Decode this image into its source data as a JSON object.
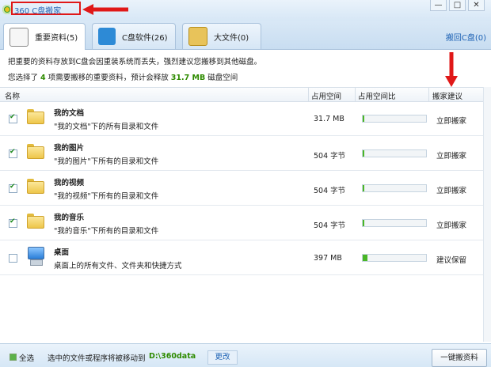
{
  "app": {
    "title": "360 C盘搬家"
  },
  "window_controls": {
    "minimize": "—",
    "maximize": "□",
    "close": "✕"
  },
  "tabs": [
    {
      "label": "重要资料(5)",
      "icon": "important-docs-icon",
      "active": true
    },
    {
      "label": "C盘软件(26)",
      "icon": "c-drive-software-icon",
      "active": false
    },
    {
      "label": "大文件(0)",
      "icon": "large-files-icon",
      "active": false
    }
  ],
  "restore_link": "搬回C盘(0)",
  "info": {
    "line1": "把重要的资料存放到C盘会因重装系统而丢失，强烈建议您搬移到其他磁盘。",
    "line2_prefix": "您选择了",
    "selected_count": "4",
    "line2_middle": "项需要搬移的重要资料，预计会释放",
    "release_size": "31.7 MB",
    "line2_suffix": "磁盘空间"
  },
  "table": {
    "headers": {
      "name": "名称",
      "size": "占用空间",
      "ratio": "占用空间比",
      "suggestion": "搬家建议"
    },
    "rows": [
      {
        "checked": true,
        "icon": "folder-icon",
        "name": "我的文档",
        "desc": "\"我的文档\"下的所有目录和文件",
        "size": "31.7 MB",
        "ratio": 0.03,
        "suggestion": "立即搬家"
      },
      {
        "checked": true,
        "icon": "folder-icon",
        "name": "我的图片",
        "desc": "\"我的图片\"下所有的目录和文件",
        "size": "504 字节",
        "ratio": 0.02,
        "suggestion": "立即搬家"
      },
      {
        "checked": true,
        "icon": "folder-icon",
        "name": "我的视频",
        "desc": "\"我的视频\"下所有的目录和文件",
        "size": "504 字节",
        "ratio": 0.02,
        "suggestion": "立即搬家"
      },
      {
        "checked": true,
        "icon": "folder-icon",
        "name": "我的音乐",
        "desc": "\"我的音乐\"下所有的目录和文件",
        "size": "504 字节",
        "ratio": 0.02,
        "suggestion": "立即搬家"
      },
      {
        "checked": false,
        "icon": "desktop-computer-icon",
        "name": "桌面",
        "desc": "桌面上的所有文件、文件夹和快捷方式",
        "size": "397 MB",
        "ratio": 0.08,
        "suggestion": "建议保留"
      }
    ]
  },
  "footer": {
    "select_all": "全选",
    "hint": "选中的文件或程序将被移动到",
    "target_path": "D:\\360data",
    "change_button": "更改",
    "move_button": "一键搬资料"
  },
  "colors": {
    "accent_green": "#2e8b00",
    "bar_green": "#49b626",
    "link_blue": "#1f63b5",
    "annotation_red": "#e01818"
  }
}
